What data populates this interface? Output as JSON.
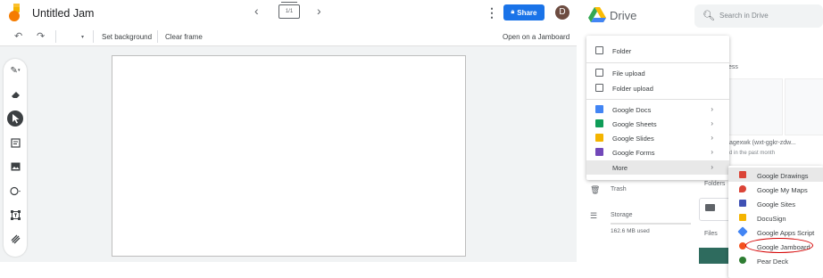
{
  "jamboard": {
    "title": "Untitled Jam",
    "frame_counter": "1/1",
    "share_label": "Share",
    "avatar_letter": "D",
    "toolbar": {
      "set_background": "Set background",
      "clear_frame": "Clear frame",
      "open_on_jamboard": "Open on a Jamboard"
    },
    "tools": [
      "pen-icon",
      "eraser-icon",
      "select-icon",
      "sticky-note-icon",
      "image-icon",
      "circle-icon",
      "text-box-icon",
      "laser-icon"
    ]
  },
  "drive": {
    "title": "Drive",
    "search_placeholder": "Search in Drive",
    "background": {
      "trash": "Trash",
      "storage": "Storage",
      "storage_used": "162.6 MB used",
      "file_name": "agexwk (wxt-ggkr-zdw...",
      "file_sub": "d in the past month",
      "folders": "Folders",
      "files": "Files",
      "ess": "ess"
    },
    "new_menu": [
      {
        "label": "Folder",
        "icon": "folder-icon",
        "color": "#5f6368",
        "arrow": false
      },
      {
        "label": "File upload",
        "icon": "file-upload-icon",
        "color": "#5f6368",
        "arrow": false
      },
      {
        "label": "Folder upload",
        "icon": "folder-upload-icon",
        "color": "#5f6368",
        "arrow": false
      },
      {
        "label": "Google Docs",
        "icon": "docs-icon",
        "color": "#4285f4",
        "arrow": true
      },
      {
        "label": "Google Sheets",
        "icon": "sheets-icon",
        "color": "#0f9d58",
        "arrow": true
      },
      {
        "label": "Google Slides",
        "icon": "slides-icon",
        "color": "#f4b400",
        "arrow": true
      },
      {
        "label": "Google Forms",
        "icon": "forms-icon",
        "color": "#7248b9",
        "arrow": true
      },
      {
        "label": "More",
        "icon": "",
        "color": "",
        "arrow": true
      }
    ],
    "more_menu": [
      {
        "label": "Google Drawings",
        "icon": "drawings-icon",
        "color": "#db4437"
      },
      {
        "label": "Google My Maps",
        "icon": "my-maps-icon",
        "color": "#db4437"
      },
      {
        "label": "Google Sites",
        "icon": "sites-icon",
        "color": "#3f51b5"
      },
      {
        "label": "DocuSign",
        "icon": "docusign-icon",
        "color": "#f4b400"
      },
      {
        "label": "Google Apps Script",
        "icon": "apps-script-icon",
        "color": "#4285f4"
      },
      {
        "label": "Google Jamboard",
        "icon": "jamboard-icon",
        "color": "#f4511e"
      },
      {
        "label": "Pear Deck",
        "icon": "pear-deck-icon",
        "color": "#2e7d32"
      }
    ]
  }
}
